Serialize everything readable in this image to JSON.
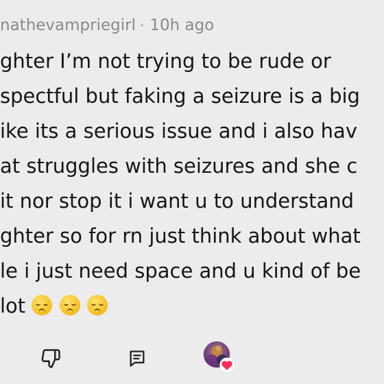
{
  "comment": {
    "username": "nathevampriegirl",
    "separator": "·",
    "time_ago": "10h ago",
    "lines": [
      "ghter I’m not trying to be rude or",
      "spectful but faking a seizure is a big",
      "ike its a serious issue and i also hav",
      "at struggles with seizures and she c",
      "it nor stop it i want u to understand",
      "ghter so for rn just think about what",
      "le i just need space and u kind of be",
      "lot"
    ],
    "emoji_name": "pensive-face",
    "emoji_count": 3
  },
  "actions": {
    "dislike_icon": "thumbs-down-icon",
    "reply_icon": "reply-comment-icon",
    "avatar_name": "creator-avatar",
    "heart_icon": "heart-icon",
    "heart_color": "#ff2f55"
  }
}
